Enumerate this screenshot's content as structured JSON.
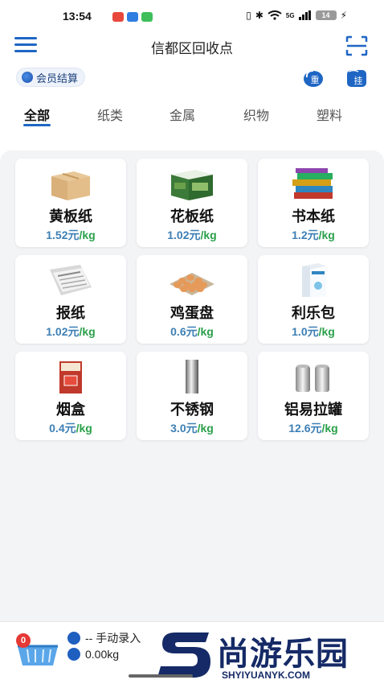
{
  "status_bar": {
    "time": "13:54",
    "network": "5G",
    "battery": "14"
  },
  "header": {
    "title": "信都区回收点"
  },
  "member": {
    "label": "会员结算"
  },
  "tools": {
    "weigh_label": "重",
    "hang_label": "挂"
  },
  "tabs": [
    "全部",
    "纸类",
    "金属",
    "织物",
    "塑料"
  ],
  "items": [
    {
      "name": "黄板纸",
      "price": "1.52元",
      "unit": "/kg",
      "icon": "cardboard-box-icon"
    },
    {
      "name": "花板纸",
      "price": "1.02元",
      "unit": "/kg",
      "icon": "printed-box-icon"
    },
    {
      "name": "书本纸",
      "price": "1.2元",
      "unit": "/kg",
      "icon": "books-icon"
    },
    {
      "name": "报纸",
      "price": "1.02元",
      "unit": "/kg",
      "icon": "newspaper-icon"
    },
    {
      "name": "鸡蛋盘",
      "price": "0.6元",
      "unit": "/kg",
      "icon": "egg-tray-icon"
    },
    {
      "name": "利乐包",
      "price": "1.0元",
      "unit": "/kg",
      "icon": "milk-carton-icon"
    },
    {
      "name": "烟盒",
      "price": "0.4元",
      "unit": "/kg",
      "icon": "cigarette-box-icon"
    },
    {
      "name": "不锈钢",
      "price": "3.0元",
      "unit": "/kg",
      "icon": "steel-pipe-icon"
    },
    {
      "name": "铝易拉罐",
      "price": "12.6元",
      "unit": "/kg",
      "icon": "aluminum-cans-icon"
    }
  ],
  "bottom": {
    "badge_count": "0",
    "entry_text": "-- 手动录入",
    "weight_text": "0.00kg"
  },
  "watermark": {
    "text": "尚游乐园",
    "sub": "SHYIYUANYK.COM"
  },
  "colors": {
    "primary": "#1f66c4",
    "price_number": "#3d7fb5",
    "price_unit": "#2aa04a",
    "background": "#f3f4f6"
  }
}
